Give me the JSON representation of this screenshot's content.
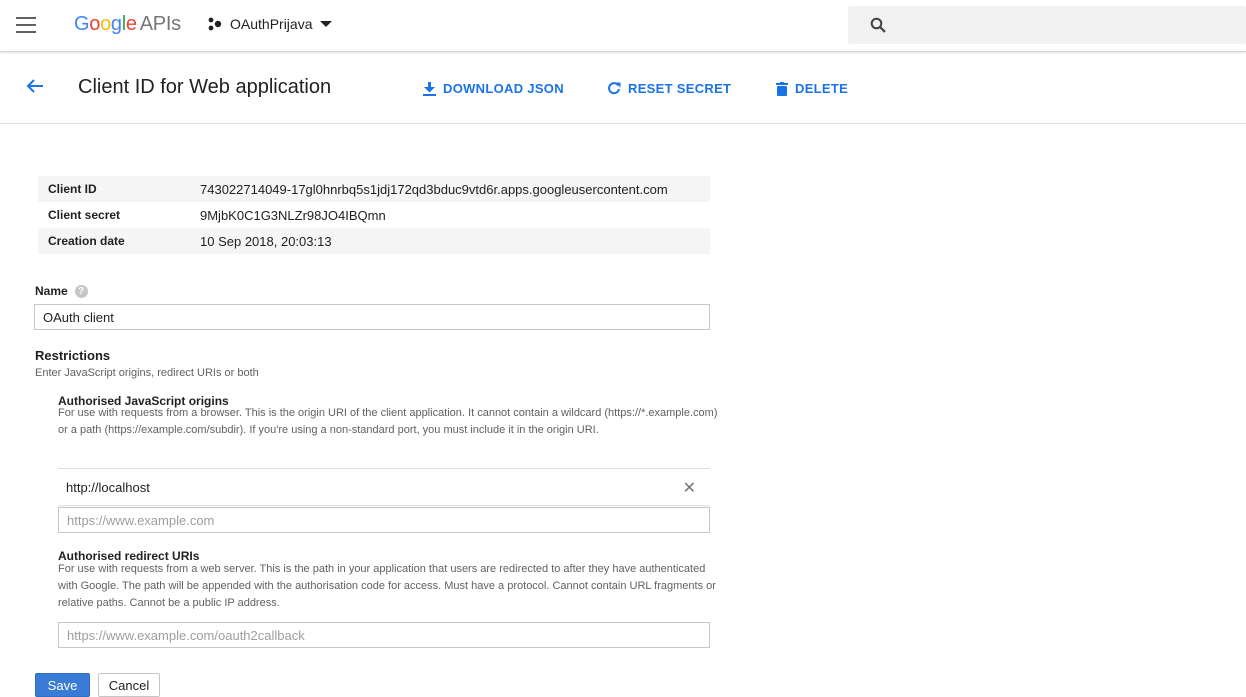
{
  "topbar": {
    "brand_letters": [
      "G",
      "o",
      "o",
      "g",
      "l",
      "e"
    ],
    "brand_suffix": "APIs",
    "project_name": "OAuthPrijava",
    "icons": [
      "menu-icon",
      "project-dots-icon",
      "chevron-down-icon",
      "search-icon"
    ]
  },
  "header": {
    "title": "Client ID for Web application",
    "actions": {
      "download": "DOWNLOAD JSON",
      "reset": "RESET SECRET",
      "delete": "DELETE"
    }
  },
  "details": [
    {
      "label": "Client ID",
      "value": "743022714049-17gl0hnrbq5s1jdj172qd3bduc9vtd6r.apps.googleusercontent.com"
    },
    {
      "label": "Client secret",
      "value": "9MjbK0C1G3NLZr98JO4IBQmn"
    },
    {
      "label": "Creation date",
      "value": "10 Sep 2018, 20:03:13"
    }
  ],
  "form": {
    "name_label": "Name",
    "name_value": "OAuth client",
    "restrictions_title": "Restrictions",
    "restrictions_sub": "Enter JavaScript origins, redirect URIs or both",
    "origins": {
      "title": "Authorised JavaScript origins",
      "desc": "For use with requests from a browser. This is the origin URI of the client application. It cannot contain a wildcard (https://*.example.com) or a path (https://example.com/subdir). If you're using a non-standard port, you must include it in the origin URI.",
      "value": "http://localhost",
      "placeholder": "https://www.example.com"
    },
    "redirect": {
      "title": "Authorised redirect URIs",
      "desc": "For use with requests from a web server. This is the path in your application that users are redirected to after they have authenticated with Google. The path will be appended with the authorisation code for access. Must have a protocol. Cannot contain URL fragments or relative paths. Cannot be a public IP address.",
      "placeholder": "https://www.example.com/oauth2callback"
    },
    "save_label": "Save",
    "cancel_label": "Cancel"
  },
  "colors": {
    "accent": "#1a73e8",
    "save_button": "#3a7bd5"
  }
}
